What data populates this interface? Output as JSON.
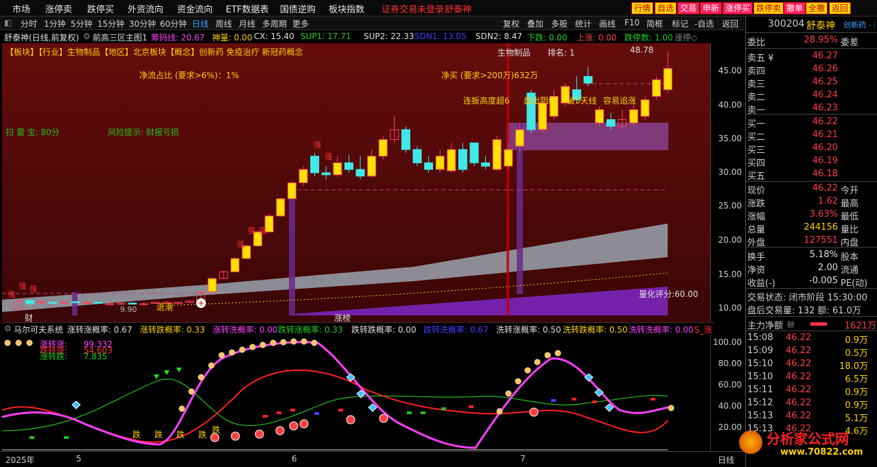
{
  "menubar": {
    "items": [
      "市场",
      "涨停卖",
      "跌停买",
      "外资流向",
      "资金流向",
      "ETF数据表",
      "国债逆购",
      "板块指数",
      "证券交易未登录",
      "舒泰神"
    ],
    "quick_buttons": [
      "行情",
      "自选",
      "交易",
      "申新",
      "涨停买",
      "跌停卖",
      "撤单",
      "全撤",
      "返回"
    ]
  },
  "toolbar": {
    "periods": [
      "分时",
      "1分钟",
      "5分钟",
      "15分钟",
      "30分钟",
      "60分钟",
      "日线",
      "周线",
      "月线",
      "多周期",
      "更多"
    ],
    "active": "日线",
    "right_tools": [
      "复权",
      "叠加",
      "多股",
      "统计",
      "画线",
      "F10",
      "简框",
      "标记",
      "-自选",
      "返回"
    ]
  },
  "infobar": {
    "title": "舒泰神(日线,前复权)",
    "indicator": "前高三区主图1",
    "chip": "筹码线: 20.67",
    "shen": "神量: 0.00",
    "cx": "CX: 15.40",
    "sup1": "SUP1: 17.71",
    "sup2": "SUP2: 22.33",
    "sdn1": "SDN1: 13.05",
    "sdn2": "SDN2: 8.47",
    "xiadie": "下跌: 0.00",
    "shangzhang": "上涨: 0.00",
    "dieting": "跌停数: 1.00",
    "zhang": "涨停◇"
  },
  "chart_notes": {
    "sector_line": "【板块】【行业】生物制品【地区】北京板块【概念】创新药 免疫治疗 新冠药概念",
    "industry": "生物制品",
    "rank": "排名: 1",
    "net_inflow_ratio": "净流占比 (要求>6%)：1%",
    "net_buy": "净买 (要求>200万)632万",
    "lianban": "连扳高度超6",
    "shadow": "盘出阴线",
    "breakline": "破5天线",
    "easy_rise": "容易追涨",
    "scan_radar": "扫 雷 宝:  80分",
    "risk": "风险提示:  财报亏损",
    "score": "量化评分:60.00",
    "high_mark": "48.78",
    "low_mark": "9.90",
    "tuichao": "退潮",
    "strong": "强",
    "cai": "财",
    "zhangbang": "涨榜"
  },
  "price_scale": [
    "45.00",
    "40.00",
    "35.00",
    "30.00",
    "25.00",
    "20.00",
    "15.00",
    "10.00"
  ],
  "sub_header": {
    "title": "马尔可夫系统",
    "items": [
      {
        "label": "涨转涨概率: 0.67",
        "color": "#e0e0e0"
      },
      {
        "label": "涨转跌概率: 0.33",
        "color": "#ffd000"
      },
      {
        "label": "涨转洗概率: 0.00",
        "color": "#ff40ff"
      },
      {
        "label": "跌转涨概率: 0.33",
        "color": "#20d020"
      },
      {
        "label": "跌转跌概率: 0.00",
        "color": "#e0e0e0"
      },
      {
        "label": "跌转洗概率: 0.67",
        "color": "#4040ff"
      },
      {
        "label": "洗转涨概率: 0.50",
        "color": "#e0e0e0"
      },
      {
        "label": "洗转跌概率: 0.50",
        "color": "#ffd000"
      },
      {
        "label": "洗转洗概率: 0.00",
        "color": "#ff40ff"
      },
      {
        "label": "S_涨",
        "color": "#ff3030"
      }
    ],
    "legend": [
      {
        "label": "涨转涨:",
        "value": "99.332",
        "color": "#ff40ff"
      },
      {
        "label": "跌转涨:",
        "value": "54.603",
        "color": "#ff3030"
      },
      {
        "label": "涨转跌:",
        "value": "7.835",
        "color": "#20d020"
      }
    ],
    "die": "跌"
  },
  "sub_scale": [
    "100.00",
    "80.00",
    "60.00",
    "40.00",
    "20.00"
  ],
  "date_axis": [
    "2025年",
    "5",
    "6",
    "7"
  ],
  "date_axis_right": "日线",
  "right_panel": {
    "code": "300204",
    "name": "舒泰神",
    "tag": "创新药 - 扶",
    "weibi_label": "委比",
    "weibi": "28.95%",
    "weicha_label": "委差",
    "asks": [
      {
        "label": "卖五 ¥",
        "price": "46.27"
      },
      {
        "label": "卖四",
        "price": "46.26"
      },
      {
        "label": "卖三",
        "price": "46.25"
      },
      {
        "label": "卖二",
        "price": "46.24"
      },
      {
        "label": "卖一",
        "price": "46.23"
      }
    ],
    "bids": [
      {
        "label": "买一",
        "price": "46.22"
      },
      {
        "label": "买二",
        "price": "46.21"
      },
      {
        "label": "买三",
        "price": "46.20"
      },
      {
        "label": "买四",
        "price": "46.19"
      },
      {
        "label": "买五",
        "price": "46.18"
      }
    ],
    "stats": [
      {
        "label": "现价",
        "value": "46.22",
        "label2": "今开"
      },
      {
        "label": "涨跌",
        "value": "1.62",
        "label2": "最高"
      },
      {
        "label": "涨幅",
        "value": "3.63%",
        "label2": "最低"
      },
      {
        "label": "总量",
        "value": "244156",
        "label2": "量比",
        "color": "#ffd000"
      },
      {
        "label": "外盘",
        "value": "127551",
        "label2": "内盘"
      }
    ],
    "stats2": [
      {
        "label": "换手",
        "value": "5.18%",
        "label2": "股本"
      },
      {
        "label": "净资",
        "value": "2.00",
        "label2": "流通"
      },
      {
        "label": "收益(-)",
        "value": "-0.005",
        "label2": "PE(动)"
      }
    ],
    "status": "交易状态: 闭市阶段 15:30:00",
    "after_hours": "盘后交易量: 132  额: 61.0万",
    "main_inflow_label": "主力净额",
    "main_inflow": "1621万",
    "ticks": [
      {
        "time": "15:08",
        "price": "46.22",
        "vol": "0.9万"
      },
      {
        "time": "15:09",
        "price": "46.22",
        "vol": "0.5万"
      },
      {
        "time": "15:10",
        "price": "46.22",
        "vol": "18.0万"
      },
      {
        "time": "15:10",
        "price": "46.22",
        "vol": "6.5万"
      },
      {
        "time": "15:11",
        "price": "46.22",
        "vol": "0.9万"
      },
      {
        "time": "15:12",
        "price": "46.22",
        "vol": "0.9万"
      },
      {
        "time": "15:13",
        "price": "46.22",
        "vol": "5.1万"
      },
      {
        "time": "15:13",
        "price": "46.22",
        "vol": "4.6万"
      }
    ]
  },
  "watermark": {
    "title": "分析家公式网",
    "url": "www.70822.com"
  },
  "chart_data": {
    "type": "candlestick",
    "ylim": [
      8,
      50
    ],
    "x": [
      "c01",
      "c02",
      "c03",
      "c04",
      "c05",
      "c06",
      "c07",
      "c08",
      "c09",
      "c10",
      "c11",
      "c12",
      "c13",
      "c14",
      "c15",
      "c16",
      "c17",
      "c18",
      "c19",
      "c20",
      "c21",
      "c22",
      "c23",
      "c24",
      "c25",
      "c26",
      "c27",
      "c28",
      "c29",
      "c30",
      "c31",
      "c32",
      "c33",
      "c34",
      "c35",
      "c36",
      "c37",
      "c38",
      "c39",
      "c40",
      "c41",
      "c42",
      "c43",
      "c44",
      "c45",
      "c46",
      "c47",
      "c48",
      "c49",
      "c50",
      "c51",
      "c52",
      "c53",
      "c54",
      "c55",
      "c56",
      "c57",
      "c58"
    ],
    "open": [
      10.0,
      11.3,
      10.9,
      11.0,
      11.0,
      11.1,
      10.9,
      11.0,
      10.8,
      10.8,
      10.9,
      10.7,
      10.9,
      11.0,
      10.9,
      11.0,
      11.2,
      12.6,
      14.6,
      15.6,
      17.6,
      19.5,
      21.6,
      24.0,
      26.6,
      29.0,
      33.0,
      30.5,
      30.2,
      32.0,
      31.0,
      30.0,
      33.0,
      35.5,
      37.0,
      34.0,
      32.0,
      31.0,
      30.8,
      34.0,
      35.0,
      32.0,
      31.0,
      31.5,
      34.5,
      42.5,
      37.0,
      39.0,
      41.0,
      43.0,
      45.0,
      38.0,
      38.5,
      37.5,
      38.0,
      39.0,
      42.0,
      43.0
    ],
    "close": [
      11.2,
      10.8,
      11.1,
      10.9,
      11.0,
      11.0,
      11.0,
      10.9,
      10.8,
      10.9,
      10.8,
      10.8,
      11.0,
      11.0,
      11.0,
      11.2,
      12.6,
      14.6,
      15.6,
      17.6,
      19.5,
      21.6,
      24.0,
      26.6,
      29.0,
      31.0,
      30.5,
      30.2,
      32.0,
      31.0,
      30.0,
      33.0,
      35.5,
      37.0,
      34.0,
      32.0,
      31.0,
      33.0,
      34.0,
      31.0,
      32.0,
      31.5,
      35.5,
      34.0,
      37.0,
      37.0,
      41.0,
      42.0,
      43.5,
      41.5,
      44.0,
      40.0,
      37.5,
      38.5,
      40.0,
      41.5,
      44.5,
      46.2
    ],
    "high": [
      11.5,
      11.5,
      11.3,
      11.2,
      11.2,
      11.2,
      11.2,
      11.1,
      11.0,
      11.0,
      11.0,
      11.0,
      11.1,
      11.2,
      11.1,
      11.3,
      12.7,
      14.7,
      15.8,
      17.8,
      19.8,
      21.8,
      24.3,
      26.8,
      29.3,
      31.5,
      33.5,
      31.5,
      33.0,
      33.2,
      33.0,
      34.0,
      36.0,
      39.0,
      37.5,
      34.5,
      33.0,
      34.0,
      35.0,
      35.0,
      35.0,
      33.0,
      36.0,
      35.0,
      38.0,
      43.0,
      42.0,
      43.0,
      44.0,
      45.0,
      46.5,
      40.5,
      39.5,
      40.0,
      41.0,
      42.0,
      45.0,
      48.8
    ],
    "low": [
      10.0,
      10.7,
      10.8,
      10.8,
      10.9,
      10.9,
      10.8,
      10.8,
      10.7,
      10.7,
      10.7,
      10.6,
      10.8,
      10.9,
      10.8,
      10.9,
      11.1,
      12.5,
      14.5,
      15.5,
      17.5,
      19.4,
      21.5,
      23.9,
      26.5,
      28.5,
      30.0,
      29.5,
      29.8,
      30.5,
      29.5,
      29.8,
      32.5,
      35.0,
      33.5,
      31.5,
      30.5,
      30.5,
      30.5,
      30.5,
      31.5,
      31.0,
      30.8,
      31.0,
      33.5,
      36.5,
      36.5,
      38.5,
      40.5,
      41.0,
      43.5,
      37.5,
      37.0,
      37.0,
      37.5,
      38.5,
      41.5,
      42.5
    ]
  }
}
